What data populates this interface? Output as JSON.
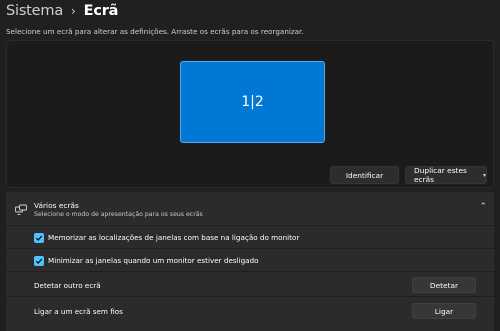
{
  "breadcrumb": {
    "parent": "Sistema",
    "separator": "›",
    "current": "Ecrã"
  },
  "hint": "Selecione um ecrã para alterar as definições. Arraste os ecrãs para os reorganizar.",
  "arrangement": {
    "monitor_label": "1|2",
    "identify_label": "Identificar",
    "duplicate_select_value": "Duplicar estes ecrãs"
  },
  "multiple_displays": {
    "title": "Vários ecrãs",
    "subtitle": "Selecione o modo de apresentação para os seus ecrãs",
    "expanded": true,
    "options": [
      {
        "label": "Memorizar as localizações de janelas com base na ligação do monitor",
        "checked": true
      },
      {
        "label": "Minimizar as janelas quando um monitor estiver desligado",
        "checked": true
      }
    ],
    "detect": {
      "label": "Detetar outro ecrã",
      "button": "Detetar"
    },
    "wireless": {
      "label": "Ligar a um ecrã sem fios",
      "button": "Ligar"
    }
  },
  "colors": {
    "accent": "#0078d4",
    "checkbox": "#4cc2ff",
    "background": "#202020",
    "card": "#2b2b2b"
  }
}
